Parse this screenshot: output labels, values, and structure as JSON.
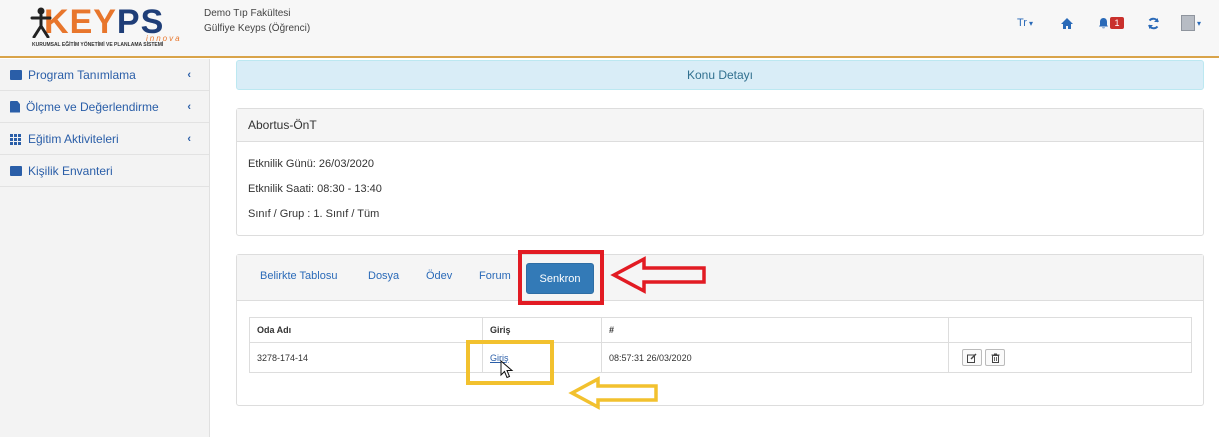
{
  "brand": {
    "logo_text_k": "K",
    "logo_text_ey": "EY",
    "logo_text_ps": "PS",
    "logo_innova": "innova",
    "logo_subtitle": "KURUMSAL EĞİTİM YÖNETİMİ VE PLANLAMA SİSTEMİ",
    "accent_color": "#e8762c",
    "brand_blue": "#1f3e78"
  },
  "header": {
    "org_name": "Demo Tıp Fakültesi",
    "user_name": "Gülfiye Keyps (Öğrenci)",
    "language": "Tr",
    "notification_count": "1",
    "icons": [
      "home-icon",
      "bell-icon",
      "refresh-icon",
      "avatar-icon"
    ]
  },
  "sidebar": {
    "items": [
      {
        "label": "Program Tanımlama",
        "icon": "list-icon",
        "expandable": true
      },
      {
        "label": "Ölçme ve Değerlendirme",
        "icon": "file-icon",
        "expandable": true
      },
      {
        "label": "Eğitim Aktiviteleri",
        "icon": "grid-icon",
        "expandable": true
      },
      {
        "label": "Kişilik Envanteri",
        "icon": "list-icon",
        "expandable": false
      }
    ]
  },
  "main": {
    "title": "Konu Detayı",
    "detail": {
      "heading": "Abortus-ÖnT",
      "lines": [
        "Etknilik Günü: 26/03/2020",
        "Etknilik Saati: 08:30 - 13:40",
        "Sınıf / Grup : 1. Sınıf / Tüm"
      ]
    },
    "tabs": [
      {
        "label": "Belirkte Tablosu",
        "active": false
      },
      {
        "label": "Dosya",
        "active": false
      },
      {
        "label": "Ödev",
        "active": false
      },
      {
        "label": "Forum",
        "active": false
      },
      {
        "label": "Senkron",
        "active": true
      }
    ],
    "table": {
      "headers": [
        "Oda Adı",
        "Giriş",
        "#",
        ""
      ],
      "rows": [
        {
          "room": "3278-174-14",
          "link": "Giriş",
          "time": "08:57:31 26/03/2020"
        }
      ]
    }
  },
  "annotations": {
    "red_color": "#e21b23",
    "yellow_color": "#f2c12e"
  }
}
